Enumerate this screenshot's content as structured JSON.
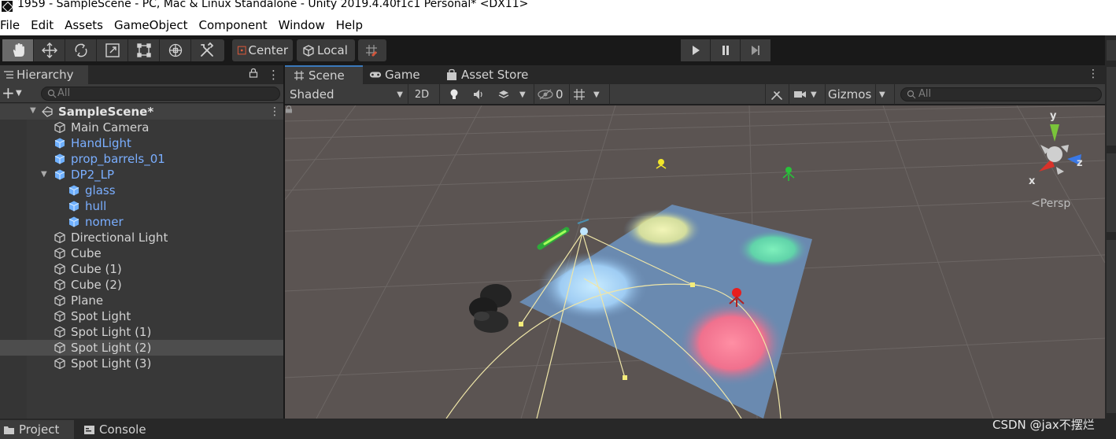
{
  "window": {
    "title": "1959 - SampleScene - PC, Mac & Linux Standalone - Unity 2019.4.40f1c1 Personal* <DX11>"
  },
  "menu": [
    "File",
    "Edit",
    "Assets",
    "GameObject",
    "Component",
    "Window",
    "Help"
  ],
  "toolbar": {
    "tools": [
      "hand-tool",
      "move-tool",
      "rotate-tool",
      "scale-tool",
      "rect-tool",
      "transform-tool",
      "custom-editor-tool"
    ],
    "active_tool": "hand-tool",
    "pivot_mode": "Center",
    "pivot_rotation": "Local"
  },
  "hierarchy": {
    "tab_label": "Hierarchy",
    "search_placeholder": "All",
    "scene_name": "SampleScene*",
    "items": [
      {
        "label": "Main Camera",
        "depth": 0,
        "prefab": false
      },
      {
        "label": "HandLight",
        "depth": 0,
        "prefab": true
      },
      {
        "label": "prop_barrels_01",
        "depth": 0,
        "prefab": true
      },
      {
        "label": "DP2_LP",
        "depth": 0,
        "prefab": true,
        "expanded": true
      },
      {
        "label": "glass",
        "depth": 1,
        "prefab": true
      },
      {
        "label": "hull",
        "depth": 1,
        "prefab": true
      },
      {
        "label": "nomer",
        "depth": 1,
        "prefab": true
      },
      {
        "label": "Directional Light",
        "depth": 0,
        "prefab": false
      },
      {
        "label": "Cube",
        "depth": 0,
        "prefab": false
      },
      {
        "label": "Cube (1)",
        "depth": 0,
        "prefab": false
      },
      {
        "label": "Cube (2)",
        "depth": 0,
        "prefab": false
      },
      {
        "label": "Plane",
        "depth": 0,
        "prefab": false
      },
      {
        "label": "Spot Light",
        "depth": 0,
        "prefab": false
      },
      {
        "label": "Spot Light (1)",
        "depth": 0,
        "prefab": false
      },
      {
        "label": "Spot Light (2)",
        "depth": 0,
        "prefab": false,
        "selected": true
      },
      {
        "label": "Spot Light (3)",
        "depth": 0,
        "prefab": false
      }
    ]
  },
  "scene_view": {
    "tabs": [
      {
        "label": "Scene",
        "icon": "grid-icon",
        "active": true
      },
      {
        "label": "Game",
        "icon": "gamepad-icon",
        "active": false
      },
      {
        "label": "Asset Store",
        "icon": "shopping-bag-icon",
        "active": false
      }
    ],
    "draw_mode": "Shaded",
    "mode_2d": "2D",
    "hidden_count": "0",
    "gizmos_label": "Gizmos",
    "search_placeholder": "All",
    "persp_label": "Persp",
    "axis_labels": {
      "x": "x",
      "y": "y",
      "z": "z"
    },
    "colors": {
      "background": "#5b5452",
      "plane": "#6a8ab0",
      "light_blue": "#a8d8ff",
      "light_yellow": "#e6ec9a",
      "light_green": "#5fe0a8",
      "light_pink": "#ff6e8a",
      "axis_x": "#d9322a",
      "axis_y": "#7ac43a",
      "axis_z": "#3a78e6"
    }
  },
  "bottom_tabs": [
    {
      "label": "Project",
      "icon": "folder-icon",
      "active": true
    },
    {
      "label": "Console",
      "icon": "console-icon",
      "active": false
    }
  ],
  "watermark": "CSDN @jax不摆烂"
}
